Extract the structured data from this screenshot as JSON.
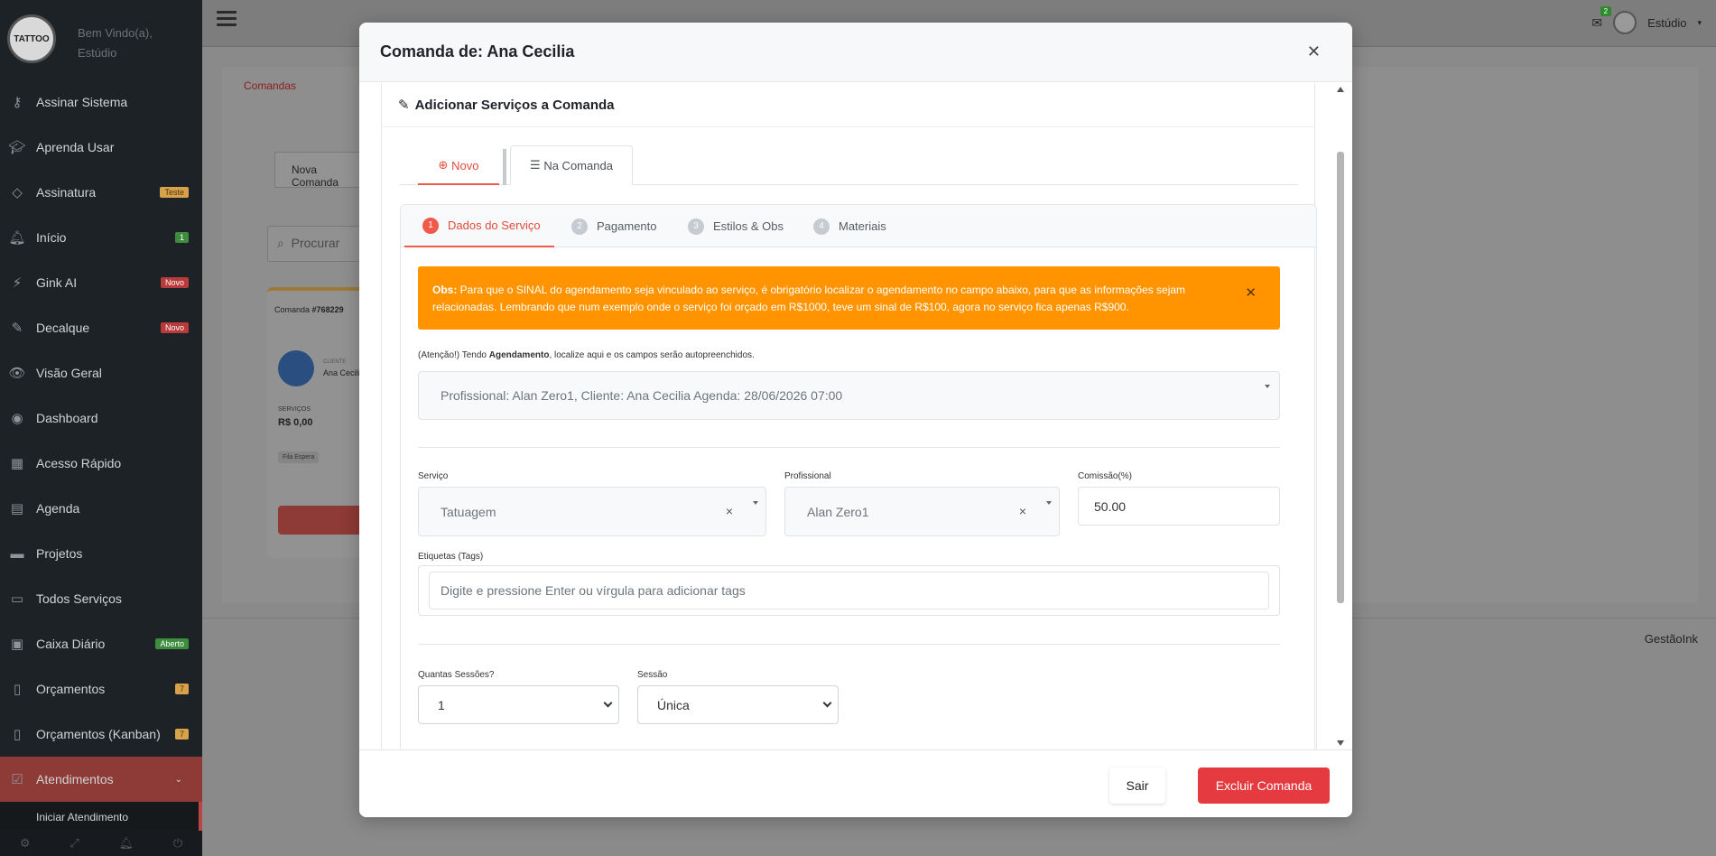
{
  "sidebar": {
    "logo_text": "TATTOO",
    "welcome": "Bem Vindo(a),",
    "welcome_name": "Estúdio",
    "items": [
      {
        "label": "Assinar Sistema",
        "icon": "key-icon",
        "badge": ""
      },
      {
        "label": "Aprenda Usar",
        "icon": "graduation-cap-icon",
        "badge": ""
      },
      {
        "label": "Assinatura",
        "icon": "diamond-icon",
        "badge": "Teste"
      },
      {
        "label": "Início",
        "icon": "bell-icon",
        "badge": "1"
      },
      {
        "label": "Gink AI",
        "icon": "magic-wand-icon",
        "badge": "Novo"
      },
      {
        "label": "Decalque",
        "icon": "brush-icon",
        "badge": "Novo"
      },
      {
        "label": "Visão Geral",
        "icon": "eye-icon",
        "badge": ""
      },
      {
        "label": "Dashboard",
        "icon": "palette-icon",
        "badge": ""
      },
      {
        "label": "Acesso Rápido",
        "icon": "grid-icon",
        "badge": ""
      },
      {
        "label": "Agenda",
        "icon": "calendar-icon",
        "badge": ""
      },
      {
        "label": "Projetos",
        "icon": "folder-icon",
        "badge": ""
      },
      {
        "label": "Todos Serviços",
        "icon": "folder-open-icon",
        "badge": ""
      },
      {
        "label": "Caixa Diário",
        "icon": "money-icon",
        "badge": "Aberto"
      },
      {
        "label": "Orçamentos",
        "icon": "file-icon",
        "badge": "7"
      },
      {
        "label": "Orçamentos (Kanban)",
        "icon": "file-icon",
        "badge": "7"
      },
      {
        "label": "Atendimentos",
        "icon": "check-square-icon",
        "badge": ""
      }
    ],
    "subitem": "Iniciar Atendimento"
  },
  "topbar": {
    "mail_badge": "2",
    "user_label": "Estúdio"
  },
  "background": {
    "breadcrumb": "Comandas",
    "tab": "Nova Comanda",
    "search_placeholder": "Procurar",
    "comanda_label": "Comanda",
    "comanda_number": "#768229",
    "client_caption": "CLIENTE",
    "client_name": "Ana Cecilia",
    "services_caption": "SERVIÇOS",
    "services_value": "R$ 0,00",
    "queue_badge": "Fila Espera",
    "footer_brand": "GestãoInk"
  },
  "modal": {
    "title": "Comanda de: Ana Cecilia",
    "panel_title": "Adicionar Serviços a Comanda",
    "tabs": {
      "novo": "Novo",
      "na_comanda": "Na Comanda"
    },
    "steps": [
      {
        "num": "1",
        "label": "Dados do Serviço"
      },
      {
        "num": "2",
        "label": "Pagamento"
      },
      {
        "num": "3",
        "label": "Estilos & Obs"
      },
      {
        "num": "4",
        "label": "Materiais"
      }
    ],
    "alert": {
      "bold": "Obs:",
      "text": " Para que o SINAL do agendamento seja vinculado ao serviço, é obrigatório localizar o agendamento no campo abaixo, para que as informações sejam relacionadas. Lembrando que num exemplo onde o serviço foi orçado em R$1000, teve um sinal de R$100, agora no serviço fica apenas R$900."
    },
    "hint_prefix": "(Atenção!) Tendo ",
    "hint_bold": "Agendamento",
    "hint_suffix": ", localize aqui e os campos serão autopreenchidos.",
    "agenda_value": "Profissional: Alan Zero1, Cliente: Ana Cecilia Agenda: 28/06/2026 07:00",
    "fields": {
      "servico_label": "Serviço",
      "servico_value": "Tatuagem",
      "profissional_label": "Profissional",
      "profissional_value": "Alan Zero1",
      "comissao_label": "Comissão(%)",
      "comissao_value": "50.00",
      "tags_label": "Etiquetas (Tags)",
      "tags_placeholder": "Digite e pressione Enter ou vírgula para adicionar tags",
      "sessoes_label": "Quantas Sessões?",
      "sessoes_value": "1",
      "sessao_label": "Sessão",
      "sessao_value": "Única"
    },
    "footer": {
      "sair": "Sair",
      "excluir": "Excluir Comanda"
    }
  },
  "colors": {
    "accent": "#ef5a4a",
    "alert": "#ff9400",
    "danger_button": "#e53a3f",
    "sidebar_bg": "#1d2227"
  }
}
